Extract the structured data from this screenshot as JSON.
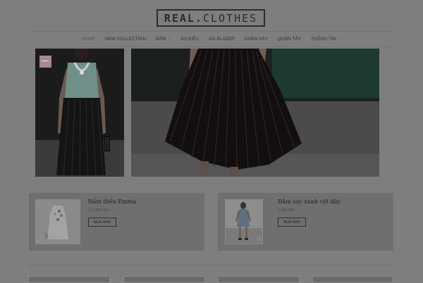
{
  "logo": {
    "bold": "REAL",
    "dot": ".",
    "light": "CLOTHES"
  },
  "nav": {
    "items": [
      {
        "label": "HOME",
        "dropdown": false
      },
      {
        "label": "NEW COLLECTION",
        "dropdown": false
      },
      {
        "label": "ĐẦM",
        "dropdown": true
      },
      {
        "label": "ÁO KIỂU",
        "dropdown": false
      },
      {
        "label": "ÁO BLAZER",
        "dropdown": false
      },
      {
        "label": "CHÂN VÁY",
        "dropdown": false
      },
      {
        "label": "QUẦN TÂY",
        "dropdown": false
      },
      {
        "label": "THÔNG TIN",
        "dropdown": true
      }
    ],
    "chevron": "⌄"
  },
  "products": [
    {
      "title": "Đầm thêu Emma",
      "price": "₫ 1,390,000",
      "buy_label": "MUA NHA!",
      "thumb_icon": "dress-photo"
    },
    {
      "title": "Đầm sọc xanh cột dây",
      "price": "₫ 690,000",
      "buy_label": "MUA NHA!",
      "thumb_icon": "model-photo"
    }
  ],
  "colors": {
    "background": "#7e7e7e",
    "card": "#6f6f6f",
    "text_dark": "#1f1f1f"
  }
}
